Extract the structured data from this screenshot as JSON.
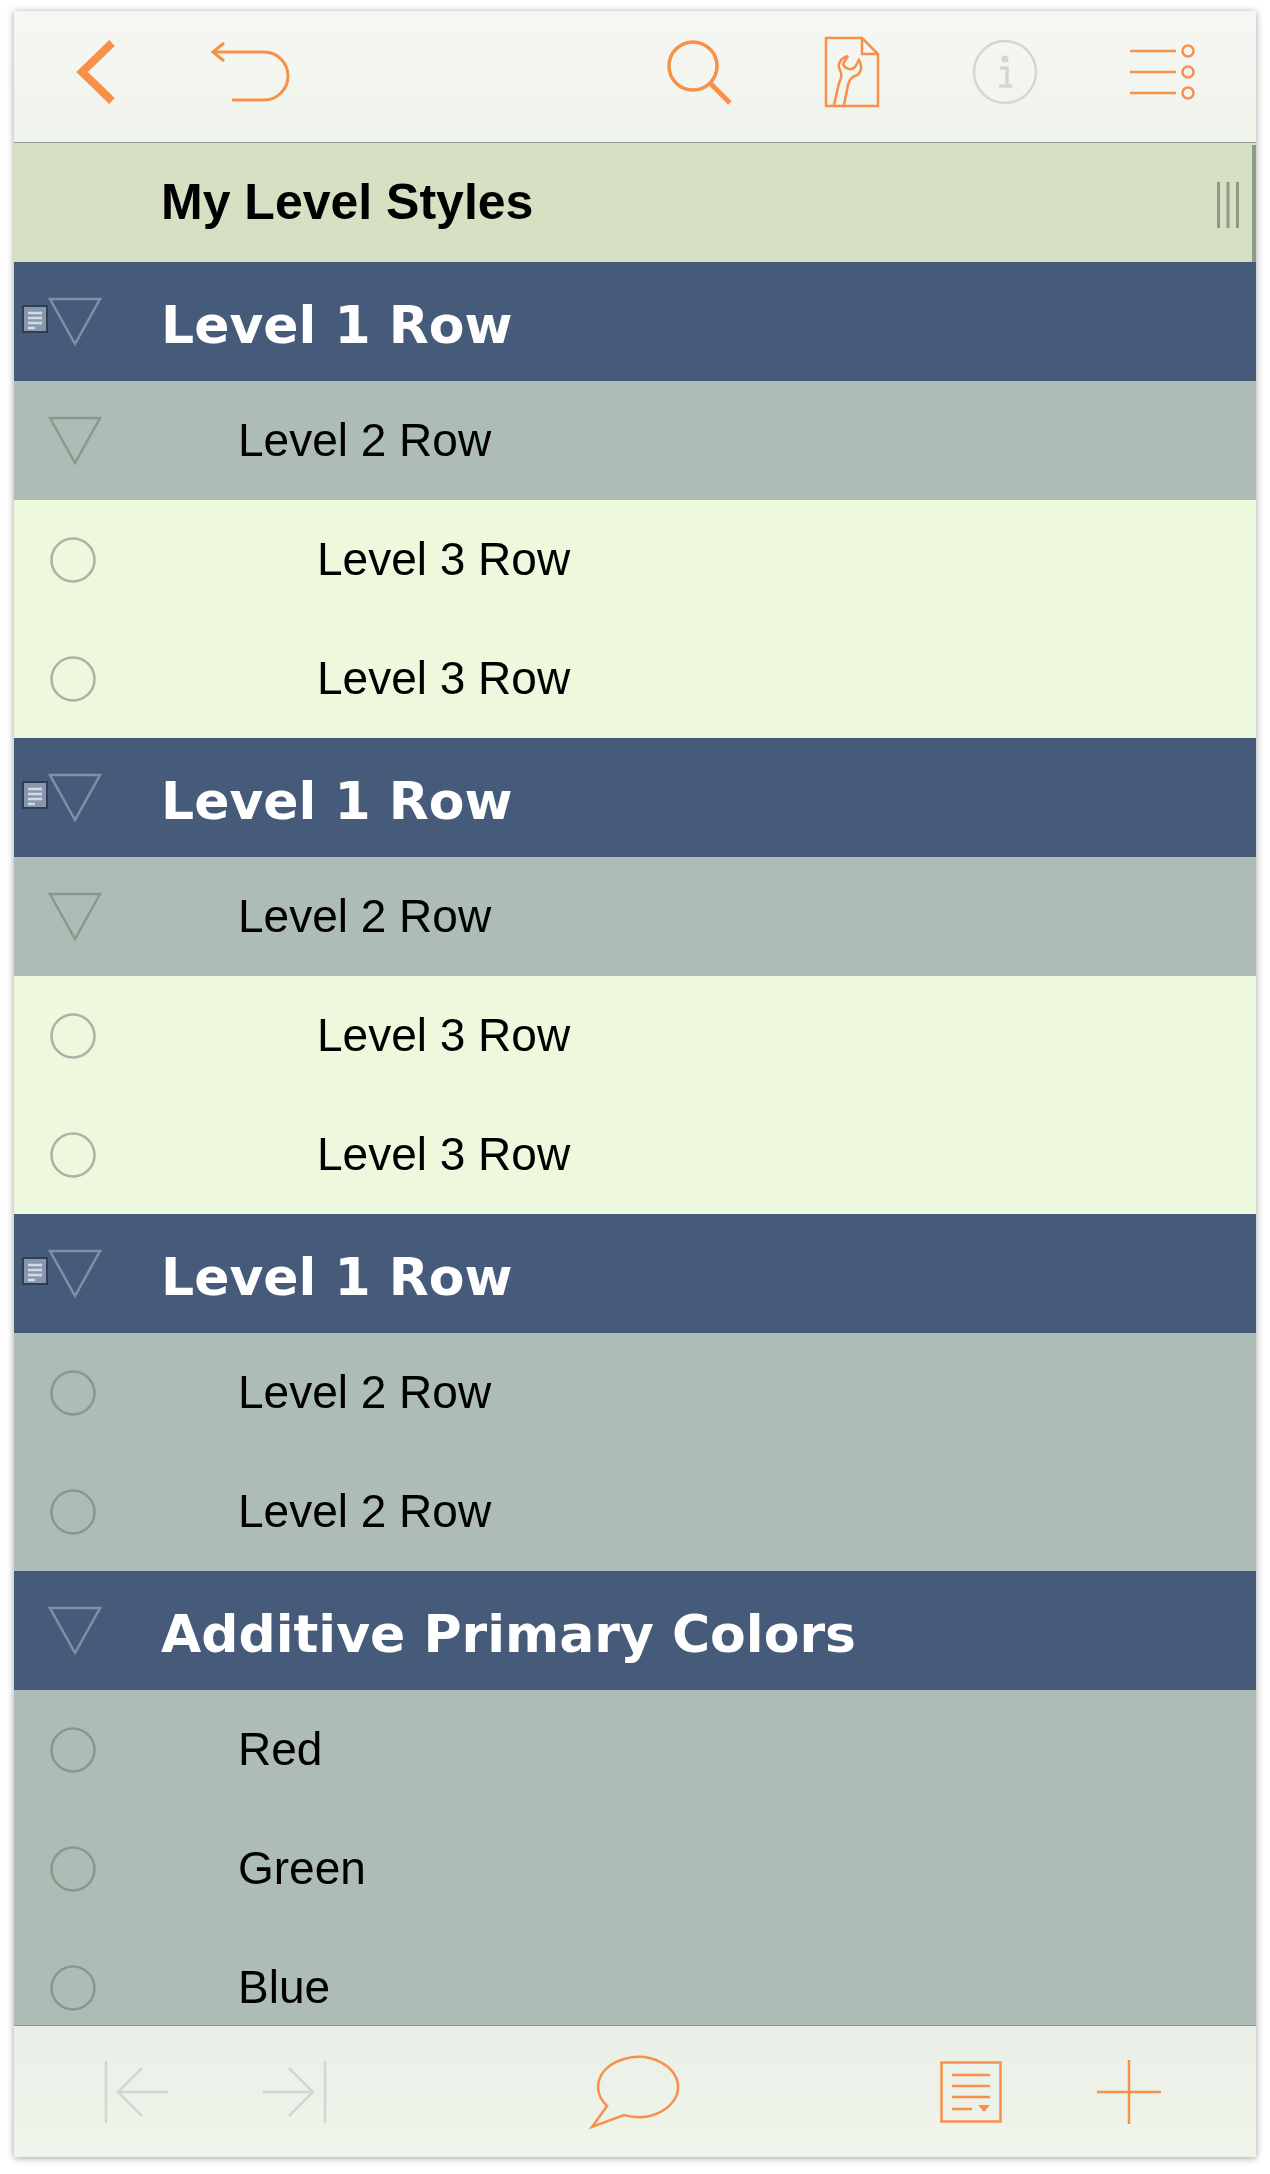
{
  "toolbar": {
    "items": [
      {
        "kind": "back",
        "disabled": false
      },
      {
        "kind": "undo",
        "disabled": false
      },
      {
        "kind": "search",
        "disabled": false
      },
      {
        "kind": "inspector",
        "disabled": false
      },
      {
        "kind": "info",
        "disabled": true
      },
      {
        "kind": "settings",
        "disabled": false
      }
    ]
  },
  "header": {
    "title": "My Level Styles"
  },
  "rows": [
    {
      "text": "Level 1 Row",
      "has_note": true,
      "expanded": true,
      "children": [
        {
          "text": "Level 2 Row",
          "expanded": true,
          "children": [
            {
              "text": "Level 3 Row"
            },
            {
              "text": "Level 3 Row"
            }
          ]
        }
      ]
    },
    {
      "text": "Level 1 Row",
      "has_note": true,
      "expanded": true,
      "children": [
        {
          "text": "Level 2 Row",
          "expanded": true,
          "children": [
            {
              "text": "Level 3 Row"
            },
            {
              "text": "Level 3 Row"
            }
          ]
        }
      ]
    },
    {
      "text": "Level 1 Row",
      "has_note": true,
      "expanded": true,
      "children": [
        {
          "text": "Level 2 Row"
        },
        {
          "text": "Level 2 Row"
        }
      ]
    },
    {
      "text": "Additive Primary Colors",
      "has_note": false,
      "expanded": true,
      "children": [
        {
          "text": "Red"
        },
        {
          "text": "Green"
        },
        {
          "text": "Blue"
        }
      ]
    }
  ],
  "bottom_bar": {
    "items": [
      {
        "kind": "first",
        "disabled": true
      },
      {
        "kind": "last",
        "disabled": true
      },
      {
        "kind": "comment",
        "disabled": false
      },
      {
        "kind": "note",
        "disabled": false
      },
      {
        "kind": "add",
        "disabled": false
      }
    ]
  }
}
